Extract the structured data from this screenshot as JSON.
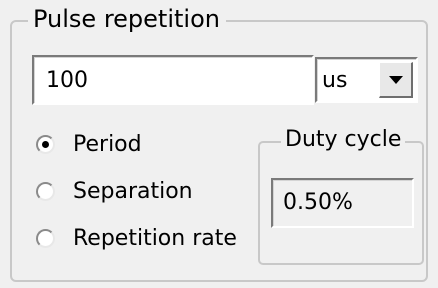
{
  "pulse_repetition": {
    "title": "Pulse repetition",
    "value_input": {
      "value": "100"
    },
    "unit_select": {
      "selected": "us"
    },
    "radios": [
      {
        "label": "Period",
        "checked": true
      },
      {
        "label": "Separation",
        "checked": false
      },
      {
        "label": "Repetition rate",
        "checked": false
      }
    ],
    "duty_cycle": {
      "title": "Duty cycle",
      "value": "0.50%"
    }
  }
}
